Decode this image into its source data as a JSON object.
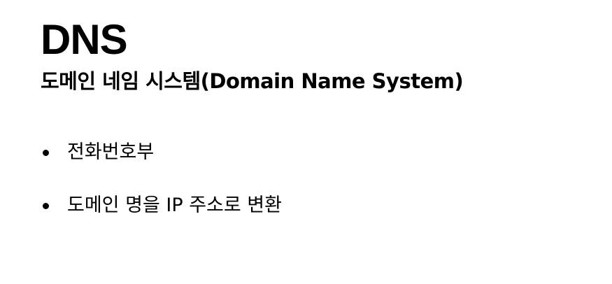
{
  "slide": {
    "title": "DNS",
    "subtitle": "도메인 네임 시스템(Domain Name System)",
    "bullets": [
      "전화번호부",
      "도메인 명을 IP 주소로 변환"
    ]
  }
}
